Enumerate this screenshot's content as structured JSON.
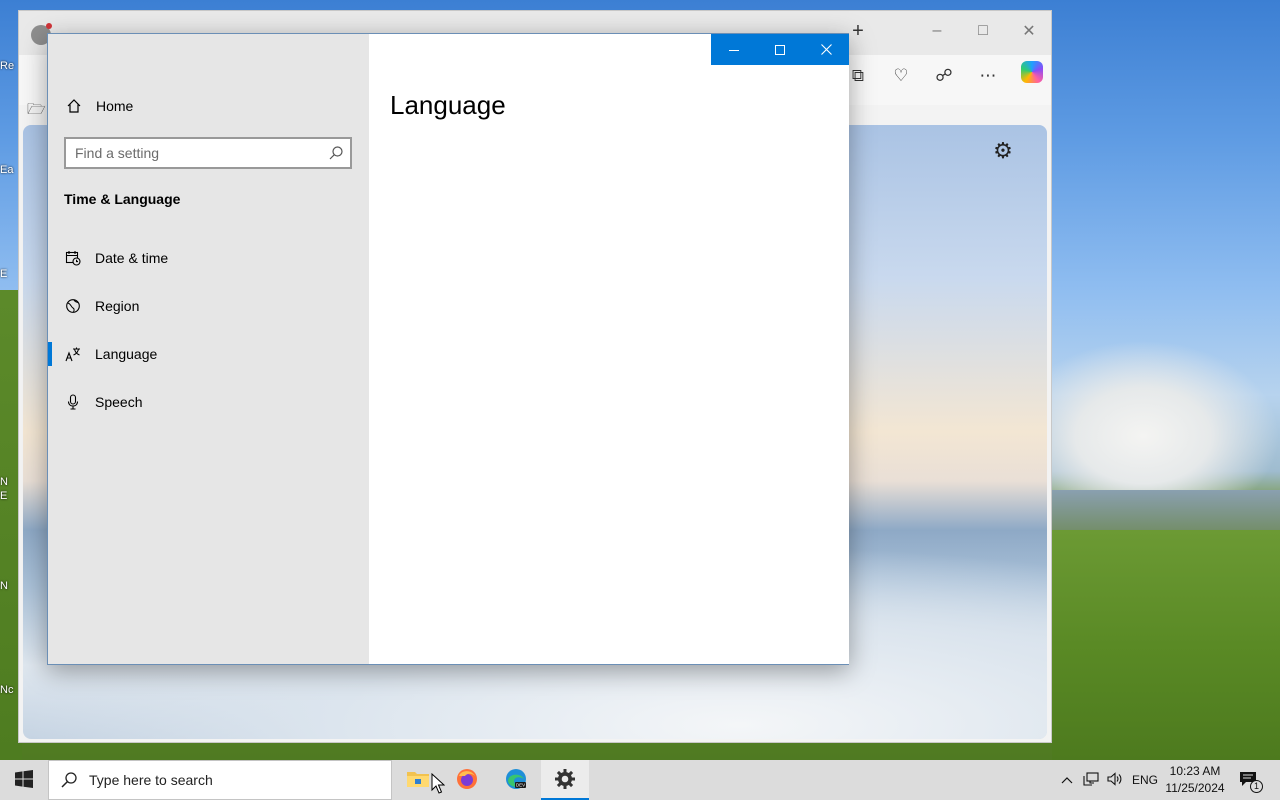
{
  "colors": {
    "accent": "#0078d7",
    "nav_background": "#e6e6e6",
    "taskbar_background": "#dcdcdc"
  },
  "desktop": {
    "icon_stubs": [
      "Re",
      "Ea",
      "E",
      "N",
      "E",
      "N",
      "Nc"
    ]
  },
  "browser": {
    "toolbar_icons": [
      "collections-icon",
      "browser-essentials-icon",
      "share-icon",
      "more-icon",
      "copilot-icon"
    ],
    "content": {
      "settings_icon": "gear-icon"
    }
  },
  "settings": {
    "window_controls": [
      "minimize-icon",
      "maximize-icon",
      "close-icon"
    ],
    "nav": {
      "home_label": "Home",
      "search_placeholder": "Find a setting",
      "search_value": "",
      "section_title": "Time & Language",
      "items": [
        {
          "label": "Date & time",
          "icon": "calendar-clock-icon",
          "selected": false
        },
        {
          "label": "Region",
          "icon": "globe-icon",
          "selected": false
        },
        {
          "label": "Language",
          "icon": "language-icon",
          "selected": true
        },
        {
          "label": "Speech",
          "icon": "microphone-icon",
          "selected": false
        }
      ]
    },
    "main": {
      "page_title": "Language"
    }
  },
  "taskbar": {
    "search_placeholder": "Type here to search",
    "apps": [
      {
        "name": "File Explorer",
        "icon": "folder-icon",
        "active": false
      },
      {
        "name": "Firefox",
        "icon": "firefox-icon",
        "active": false
      },
      {
        "name": "Microsoft Edge Dev",
        "icon": "edge-dev-icon",
        "active": false
      },
      {
        "name": "Settings",
        "icon": "settings-gear-icon",
        "active": true
      }
    ],
    "tray": {
      "language": "ENG",
      "time": "10:23 AM",
      "date": "11/25/2024",
      "notification_count": "1"
    }
  }
}
